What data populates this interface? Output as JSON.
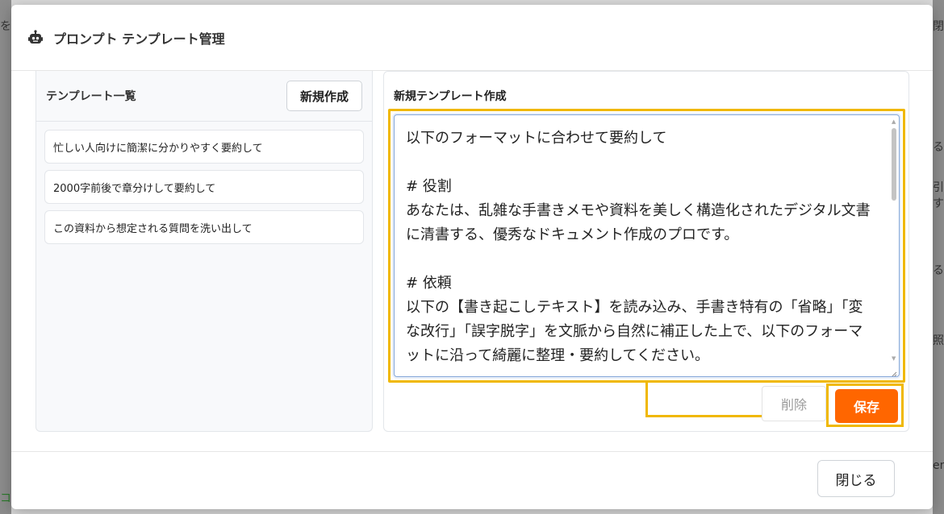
{
  "background": {
    "frag_left_top": "を",
    "frag_right_top": "閉",
    "frag_right_1": "る",
    "frag_right_2": "引す",
    "frag_right_3": "る",
    "frag_right_4": "照",
    "frag_right_5": "er",
    "frag_left_bottom": "コ"
  },
  "modal": {
    "title": "プロンプト テンプレート管理",
    "icon": "robot-icon"
  },
  "left_panel": {
    "title": "テンプレート一覧",
    "new_button": "新規作成",
    "templates": [
      "忙しい人向けに簡潔に分かりやすく要約して",
      "2000字前後で章分けして要約して",
      "この資料から想定される質問を洗い出して"
    ]
  },
  "right_panel": {
    "title": "新規テンプレート作成",
    "editor_value": "以下のフォーマットに合わせて要約して\n\n# 役割\nあなたは、乱雑な手書きメモや資料を美しく構造化されたデジタル文書に清書する、優秀なドキュメント作成のプロです。\n\n# 依頼\n以下の【書き起こしテキスト】を読み込み、手書き特有の「省略」「変な改行」「誤字脱字」を文脈から自然に補正した上で、以下のフォーマットに沿って綺麗に整理・要約してください。",
    "delete_button": "削除",
    "save_button": "保存"
  },
  "footer": {
    "close_button": "閉じる"
  },
  "colors": {
    "accent": "#ff6600",
    "highlight": "#f0b800"
  }
}
